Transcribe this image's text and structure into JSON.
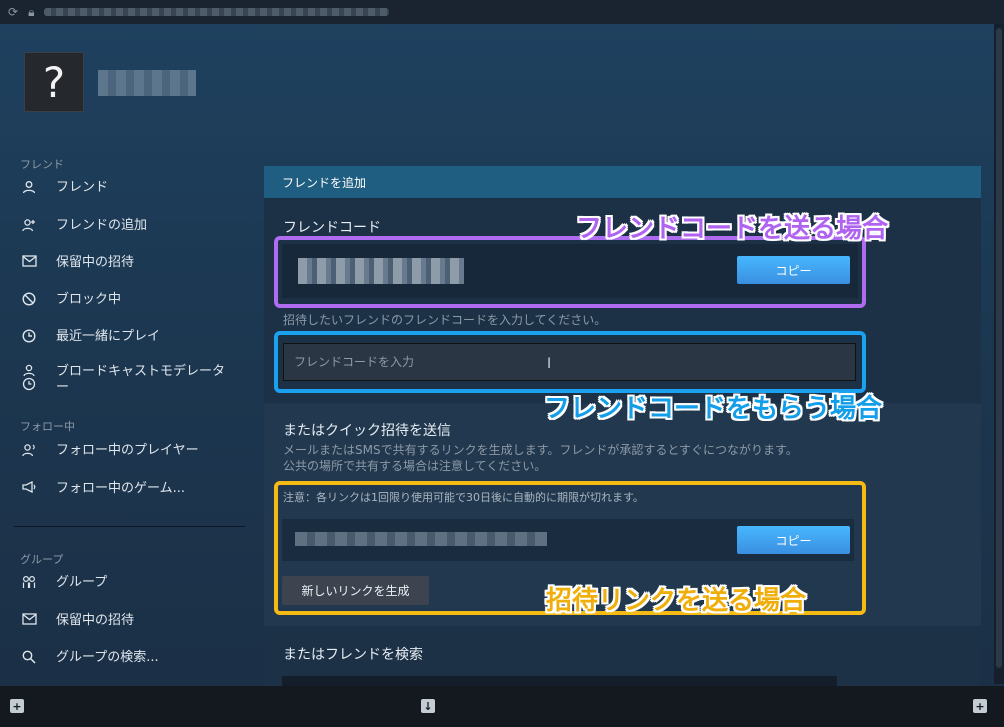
{
  "urlbar": {
    "icons": [
      "refresh-icon",
      "lock-icon"
    ]
  },
  "profile": {
    "avatar_glyph": "?"
  },
  "sidebar": {
    "section_friends": "フレンド",
    "friends_items": [
      {
        "label": "フレンド",
        "icon": "user-icon"
      },
      {
        "label": "フレンドの追加",
        "icon": "user-plus-icon"
      },
      {
        "label": "保留中の招待",
        "icon": "mail-icon"
      },
      {
        "label": "ブロック中",
        "icon": "block-icon"
      },
      {
        "label": "最近一緒にプレイ",
        "icon": "clock-icon"
      },
      {
        "label": "ブロードキャストモデレーター",
        "icon": "user-clock-icon"
      }
    ],
    "section_following": "フォロー中",
    "following_items": [
      {
        "label": "フォロー中のプレイヤー",
        "icon": "user-follow-icon"
      },
      {
        "label": "フォロー中のゲーム...",
        "icon": "megaphone-icon"
      }
    ],
    "section_groups": "グループ",
    "group_items": [
      {
        "label": "グループ",
        "icon": "group-icon"
      },
      {
        "label": "保留中の招待",
        "icon": "mail-icon"
      },
      {
        "label": "グループの検索...",
        "icon": "search-icon"
      }
    ]
  },
  "panel": {
    "header": "フレンドを追加",
    "friend_code_title": "フレンドコード",
    "copy_label": "コピー",
    "enter_hint": "招待したいフレンドのフレンドコードを入力してください。",
    "input_placeholder": "フレンドコードを入力",
    "quick_invite_title": "またはクイック招待を送信",
    "quick_invite_desc1": "メールまたはSMSで共有するリンクを生成します。フレンドが承認するとすぐにつながります。",
    "quick_invite_desc2": "公共の場所で共有する場合は注意してください。",
    "link_warning": "注意：各リンクは1回限り使用可能で30日後に自動的に期限が切れます。",
    "copy_label2": "コピー",
    "generate_link": "新しいリンクを生成",
    "search_title": "またはフレンドを検索"
  },
  "annotations": {
    "send_code": "フレンドコードを送る場合",
    "receive_code": "フレンドコードをもらう場合",
    "send_link": "招待リンクを送る場合",
    "colors": {
      "purple": "#b06cf0",
      "blue": "#1aa2f0",
      "yellow": "#f5ba14"
    }
  },
  "bottombar": {
    "add_game": "ゲームを追加",
    "downloads": "ダウンロードの管理",
    "friends_chat": "フレンド&チャット"
  }
}
